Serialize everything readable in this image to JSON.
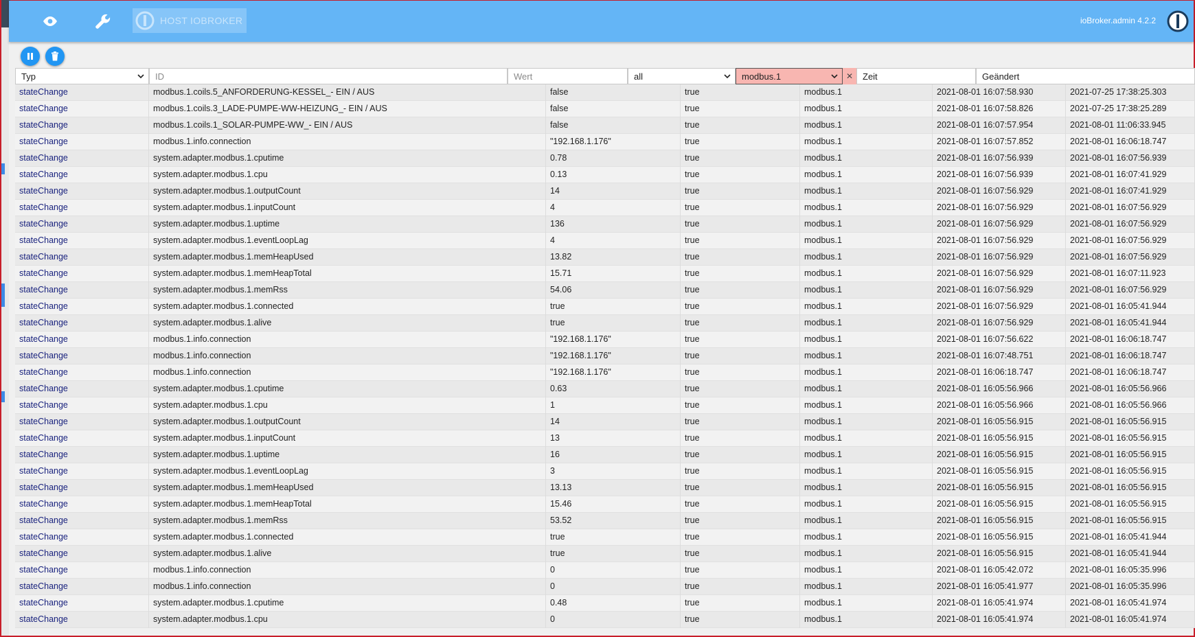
{
  "header": {
    "host_label": "HOST IOBROKER",
    "version": "ioBroker.admin 4.2.2",
    "icons": [
      "eye-icon",
      "wrench-icon",
      "iobroker-logo-icon"
    ]
  },
  "actions": {
    "pause_icon": "pause-icon",
    "delete_icon": "trash-icon"
  },
  "filters": {
    "type": "Typ",
    "id_placeholder": "ID",
    "value_placeholder": "Wert",
    "ack": "all",
    "from": "modbus.1",
    "time_label": "Zeit",
    "changed_label": "Geändert"
  },
  "rows": [
    [
      "stateChange",
      "modbus.1.coils.5_ANFORDERUNG-KESSEL_- EIN / AUS",
      "false",
      "true",
      "modbus.1",
      "2021-08-01 16:07:58.930",
      "2021-07-25 17:38:25.303"
    ],
    [
      "stateChange",
      "modbus.1.coils.3_LADE-PUMPE-WW-HEIZUNG_- EIN / AUS",
      "false",
      "true",
      "modbus.1",
      "2021-08-01 16:07:58.826",
      "2021-07-25 17:38:25.289"
    ],
    [
      "stateChange",
      "modbus.1.coils.1_SOLAR-PUMPE-WW_- EIN / AUS",
      "false",
      "true",
      "modbus.1",
      "2021-08-01 16:07:57.954",
      "2021-08-01 11:06:33.945"
    ],
    [
      "stateChange",
      "modbus.1.info.connection",
      "\"192.168.1.176\"",
      "true",
      "modbus.1",
      "2021-08-01 16:07:57.852",
      "2021-08-01 16:06:18.747"
    ],
    [
      "stateChange",
      "system.adapter.modbus.1.cputime",
      "0.78",
      "true",
      "modbus.1",
      "2021-08-01 16:07:56.939",
      "2021-08-01 16:07:56.939"
    ],
    [
      "stateChange",
      "system.adapter.modbus.1.cpu",
      "0.13",
      "true",
      "modbus.1",
      "2021-08-01 16:07:56.939",
      "2021-08-01 16:07:41.929"
    ],
    [
      "stateChange",
      "system.adapter.modbus.1.outputCount",
      "14",
      "true",
      "modbus.1",
      "2021-08-01 16:07:56.929",
      "2021-08-01 16:07:41.929"
    ],
    [
      "stateChange",
      "system.adapter.modbus.1.inputCount",
      "4",
      "true",
      "modbus.1",
      "2021-08-01 16:07:56.929",
      "2021-08-01 16:07:56.929"
    ],
    [
      "stateChange",
      "system.adapter.modbus.1.uptime",
      "136",
      "true",
      "modbus.1",
      "2021-08-01 16:07:56.929",
      "2021-08-01 16:07:56.929"
    ],
    [
      "stateChange",
      "system.adapter.modbus.1.eventLoopLag",
      "4",
      "true",
      "modbus.1",
      "2021-08-01 16:07:56.929",
      "2021-08-01 16:07:56.929"
    ],
    [
      "stateChange",
      "system.adapter.modbus.1.memHeapUsed",
      "13.82",
      "true",
      "modbus.1",
      "2021-08-01 16:07:56.929",
      "2021-08-01 16:07:56.929"
    ],
    [
      "stateChange",
      "system.adapter.modbus.1.memHeapTotal",
      "15.71",
      "true",
      "modbus.1",
      "2021-08-01 16:07:56.929",
      "2021-08-01 16:07:11.923"
    ],
    [
      "stateChange",
      "system.adapter.modbus.1.memRss",
      "54.06",
      "true",
      "modbus.1",
      "2021-08-01 16:07:56.929",
      "2021-08-01 16:07:56.929"
    ],
    [
      "stateChange",
      "system.adapter.modbus.1.connected",
      "true",
      "true",
      "modbus.1",
      "2021-08-01 16:07:56.929",
      "2021-08-01 16:05:41.944"
    ],
    [
      "stateChange",
      "system.adapter.modbus.1.alive",
      "true",
      "true",
      "modbus.1",
      "2021-08-01 16:07:56.929",
      "2021-08-01 16:05:41.944"
    ],
    [
      "stateChange",
      "modbus.1.info.connection",
      "\"192.168.1.176\"",
      "true",
      "modbus.1",
      "2021-08-01 16:07:56.622",
      "2021-08-01 16:06:18.747"
    ],
    [
      "stateChange",
      "modbus.1.info.connection",
      "\"192.168.1.176\"",
      "true",
      "modbus.1",
      "2021-08-01 16:07:48.751",
      "2021-08-01 16:06:18.747"
    ],
    [
      "stateChange",
      "modbus.1.info.connection",
      "\"192.168.1.176\"",
      "true",
      "modbus.1",
      "2021-08-01 16:06:18.747",
      "2021-08-01 16:06:18.747"
    ],
    [
      "stateChange",
      "system.adapter.modbus.1.cputime",
      "0.63",
      "true",
      "modbus.1",
      "2021-08-01 16:05:56.966",
      "2021-08-01 16:05:56.966"
    ],
    [
      "stateChange",
      "system.adapter.modbus.1.cpu",
      "1",
      "true",
      "modbus.1",
      "2021-08-01 16:05:56.966",
      "2021-08-01 16:05:56.966"
    ],
    [
      "stateChange",
      "system.adapter.modbus.1.outputCount",
      "14",
      "true",
      "modbus.1",
      "2021-08-01 16:05:56.915",
      "2021-08-01 16:05:56.915"
    ],
    [
      "stateChange",
      "system.adapter.modbus.1.inputCount",
      "13",
      "true",
      "modbus.1",
      "2021-08-01 16:05:56.915",
      "2021-08-01 16:05:56.915"
    ],
    [
      "stateChange",
      "system.adapter.modbus.1.uptime",
      "16",
      "true",
      "modbus.1",
      "2021-08-01 16:05:56.915",
      "2021-08-01 16:05:56.915"
    ],
    [
      "stateChange",
      "system.adapter.modbus.1.eventLoopLag",
      "3",
      "true",
      "modbus.1",
      "2021-08-01 16:05:56.915",
      "2021-08-01 16:05:56.915"
    ],
    [
      "stateChange",
      "system.adapter.modbus.1.memHeapUsed",
      "13.13",
      "true",
      "modbus.1",
      "2021-08-01 16:05:56.915",
      "2021-08-01 16:05:56.915"
    ],
    [
      "stateChange",
      "system.adapter.modbus.1.memHeapTotal",
      "15.46",
      "true",
      "modbus.1",
      "2021-08-01 16:05:56.915",
      "2021-08-01 16:05:56.915"
    ],
    [
      "stateChange",
      "system.adapter.modbus.1.memRss",
      "53.52",
      "true",
      "modbus.1",
      "2021-08-01 16:05:56.915",
      "2021-08-01 16:05:56.915"
    ],
    [
      "stateChange",
      "system.adapter.modbus.1.connected",
      "true",
      "true",
      "modbus.1",
      "2021-08-01 16:05:56.915",
      "2021-08-01 16:05:41.944"
    ],
    [
      "stateChange",
      "system.adapter.modbus.1.alive",
      "true",
      "true",
      "modbus.1",
      "2021-08-01 16:05:56.915",
      "2021-08-01 16:05:41.944"
    ],
    [
      "stateChange",
      "modbus.1.info.connection",
      "0",
      "true",
      "modbus.1",
      "2021-08-01 16:05:42.072",
      "2021-08-01 16:05:35.996"
    ],
    [
      "stateChange",
      "modbus.1.info.connection",
      "0",
      "true",
      "modbus.1",
      "2021-08-01 16:05:41.977",
      "2021-08-01 16:05:35.996"
    ],
    [
      "stateChange",
      "system.adapter.modbus.1.cputime",
      "0.48",
      "true",
      "modbus.1",
      "2021-08-01 16:05:41.974",
      "2021-08-01 16:05:41.974"
    ],
    [
      "stateChange",
      "system.adapter.modbus.1.cpu",
      "0",
      "true",
      "modbus.1",
      "2021-08-01 16:05:41.974",
      "2021-08-01 16:05:41.974"
    ]
  ]
}
